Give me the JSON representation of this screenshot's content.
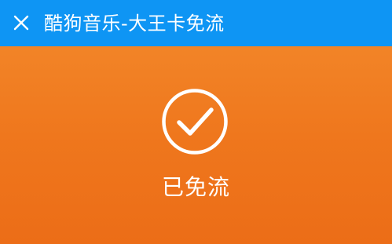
{
  "header": {
    "title": "酷狗音乐-大王卡免流",
    "close_icon": "close-icon",
    "background": "#0e95f4"
  },
  "main": {
    "status_icon": "check-circle-icon",
    "status_text": "已免流",
    "background": "#f07a1e"
  }
}
